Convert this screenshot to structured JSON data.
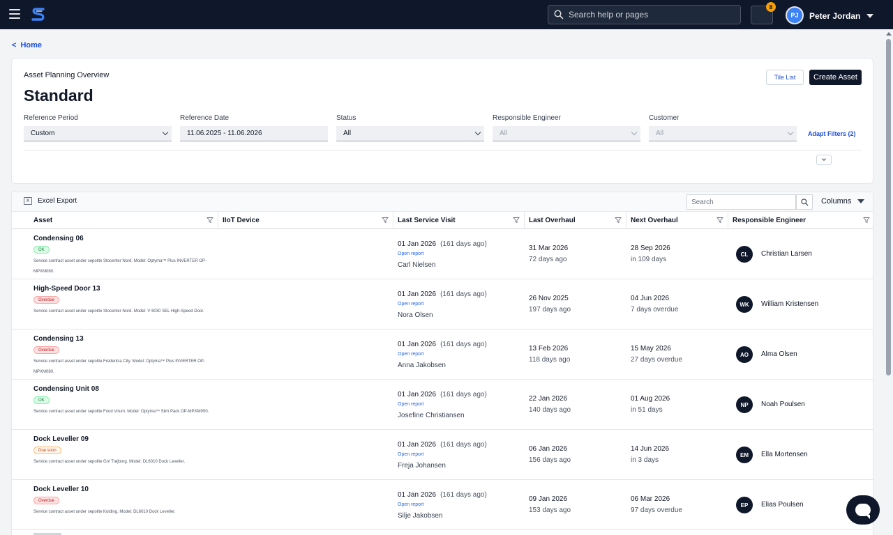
{
  "topbar": {
    "search_placeholder": "Search help or pages",
    "notification_count": "8",
    "user_initials": "PJ",
    "user_name": "Peter Jordan"
  },
  "breadcrumb": {
    "chevron": "<",
    "label": "Home"
  },
  "header": {
    "overline": "Asset Planning Overview",
    "title": "Standard",
    "tile_list_label": "Tile List",
    "create_asset_label": "Create Asset",
    "adapt_filters_label": "Adapt Filters (2)"
  },
  "filters": [
    {
      "label": "Reference Period",
      "value": "Custom",
      "disabled": false
    },
    {
      "label": "Reference Date",
      "value": "11.06.2025 - 11.06.2026",
      "disabled": false
    },
    {
      "label": "Status",
      "value": "All",
      "disabled": false
    },
    {
      "label": "Responsible Engineer",
      "value": "All",
      "disabled": true
    },
    {
      "label": "Customer",
      "value": "All",
      "disabled": true
    }
  ],
  "toolbar": {
    "excel_icon": "X",
    "excel_label": "Excel Export",
    "search_placeholder": "Search",
    "columns_label": "Columns"
  },
  "columns": [
    "Asset",
    "IIoT Device",
    "Last Service Visit",
    "Last Overhaul",
    "Next Overhaul",
    "Responsible Engineer"
  ],
  "rows": [
    {
      "name": "Condensing 06",
      "status": "OK",
      "status_type": "ok",
      "description": "Service contract asset under sepolite Stocenter Nord. Model: Optyma™ Plus INVERTER OP-MPXM080.",
      "last_service_date": "01 Jan 2026",
      "last_service_ago": "(161 days ago)",
      "report_link": "Open report",
      "service_person": "Carl Nielsen",
      "last_overhaul": "31 Mar 2026",
      "last_overhaul_sub": "72 days ago",
      "next_overhaul": "28 Sep 2026",
      "next_overhaul_sub": "in 109 days",
      "engineer_initials": "CL",
      "engineer": "Christian Larsen"
    },
    {
      "name": "High-Speed Door 13",
      "status": "Overdue",
      "status_type": "overdue",
      "description": "Service contract asset under sepolite Stocenter Nord. Model: V 6030 SEL High-Speed Door.",
      "last_service_date": "01 Jan 2026",
      "last_service_ago": "(161 days ago)",
      "report_link": "Open report",
      "service_person": "Nora Olsen",
      "last_overhaul": "26 Nov 2025",
      "last_overhaul_sub": "197 days ago",
      "next_overhaul": "04 Jun 2026",
      "next_overhaul_sub": "7 days overdue",
      "engineer_initials": "WK",
      "engineer": "William Kristensen"
    },
    {
      "name": "Condensing 13",
      "status": "Overdue",
      "status_type": "overdue",
      "description": "Service contract asset under sepolite Fredericia City. Model: Optyma™ Plus INVERTER OP-MPXM080.",
      "last_service_date": "01 Jan 2026",
      "last_service_ago": "(161 days ago)",
      "report_link": "Open report",
      "service_person": "Anna Jakobsen",
      "last_overhaul": "13 Feb 2026",
      "last_overhaul_sub": "118 days ago",
      "next_overhaul": "15 May 2026",
      "next_overhaul_sub": "27 days overdue",
      "engineer_initials": "AO",
      "engineer": "Alma Olsen"
    },
    {
      "name": "Condensing Unit 08",
      "status": "OK",
      "status_type": "ok",
      "description": "Service contract asset under sepolite Food Virum. Model: Optyma™ Slim Pack OP-MPXM050.",
      "last_service_date": "01 Jan 2026",
      "last_service_ago": "(161 days ago)",
      "report_link": "Open report",
      "service_person": "Josefine Christiansen",
      "last_overhaul": "22 Jan 2026",
      "last_overhaul_sub": "140 days ago",
      "next_overhaul": "01 Aug 2026",
      "next_overhaul_sub": "in 51 days",
      "engineer_initials": "NP",
      "engineer": "Noah Poulsen"
    },
    {
      "name": "Dock Leveller 09",
      "status": "Due soon",
      "status_type": "soon",
      "description": "Service contract asset under sepolite Go! Trøjborg. Model: DL6010 Dock Leveller.",
      "last_service_date": "01 Jan 2026",
      "last_service_ago": "(161 days ago)",
      "report_link": "Open report",
      "service_person": "Freja Johansen",
      "last_overhaul": "06 Jan 2026",
      "last_overhaul_sub": "156 days ago",
      "next_overhaul": "14 Jun 2026",
      "next_overhaul_sub": "in 3 days",
      "engineer_initials": "EM",
      "engineer": "Ella Mortensen"
    },
    {
      "name": "Dock Leveller 10",
      "status": "Overdue",
      "status_type": "overdue",
      "description": "Service contract asset under sepolite Kolding. Model: DL6010 Dock Leveller.",
      "last_service_date": "01 Jan 2026",
      "last_service_ago": "(161 days ago)",
      "report_link": "Open report",
      "service_person": "Silje Jakobsen",
      "last_overhaul": "09 Jan 2026",
      "last_overhaul_sub": "153 days ago",
      "next_overhaul": "06 Mar 2026",
      "next_overhaul_sub": "97 days overdue",
      "engineer_initials": "EP",
      "engineer": "Elias Poulsen"
    }
  ]
}
